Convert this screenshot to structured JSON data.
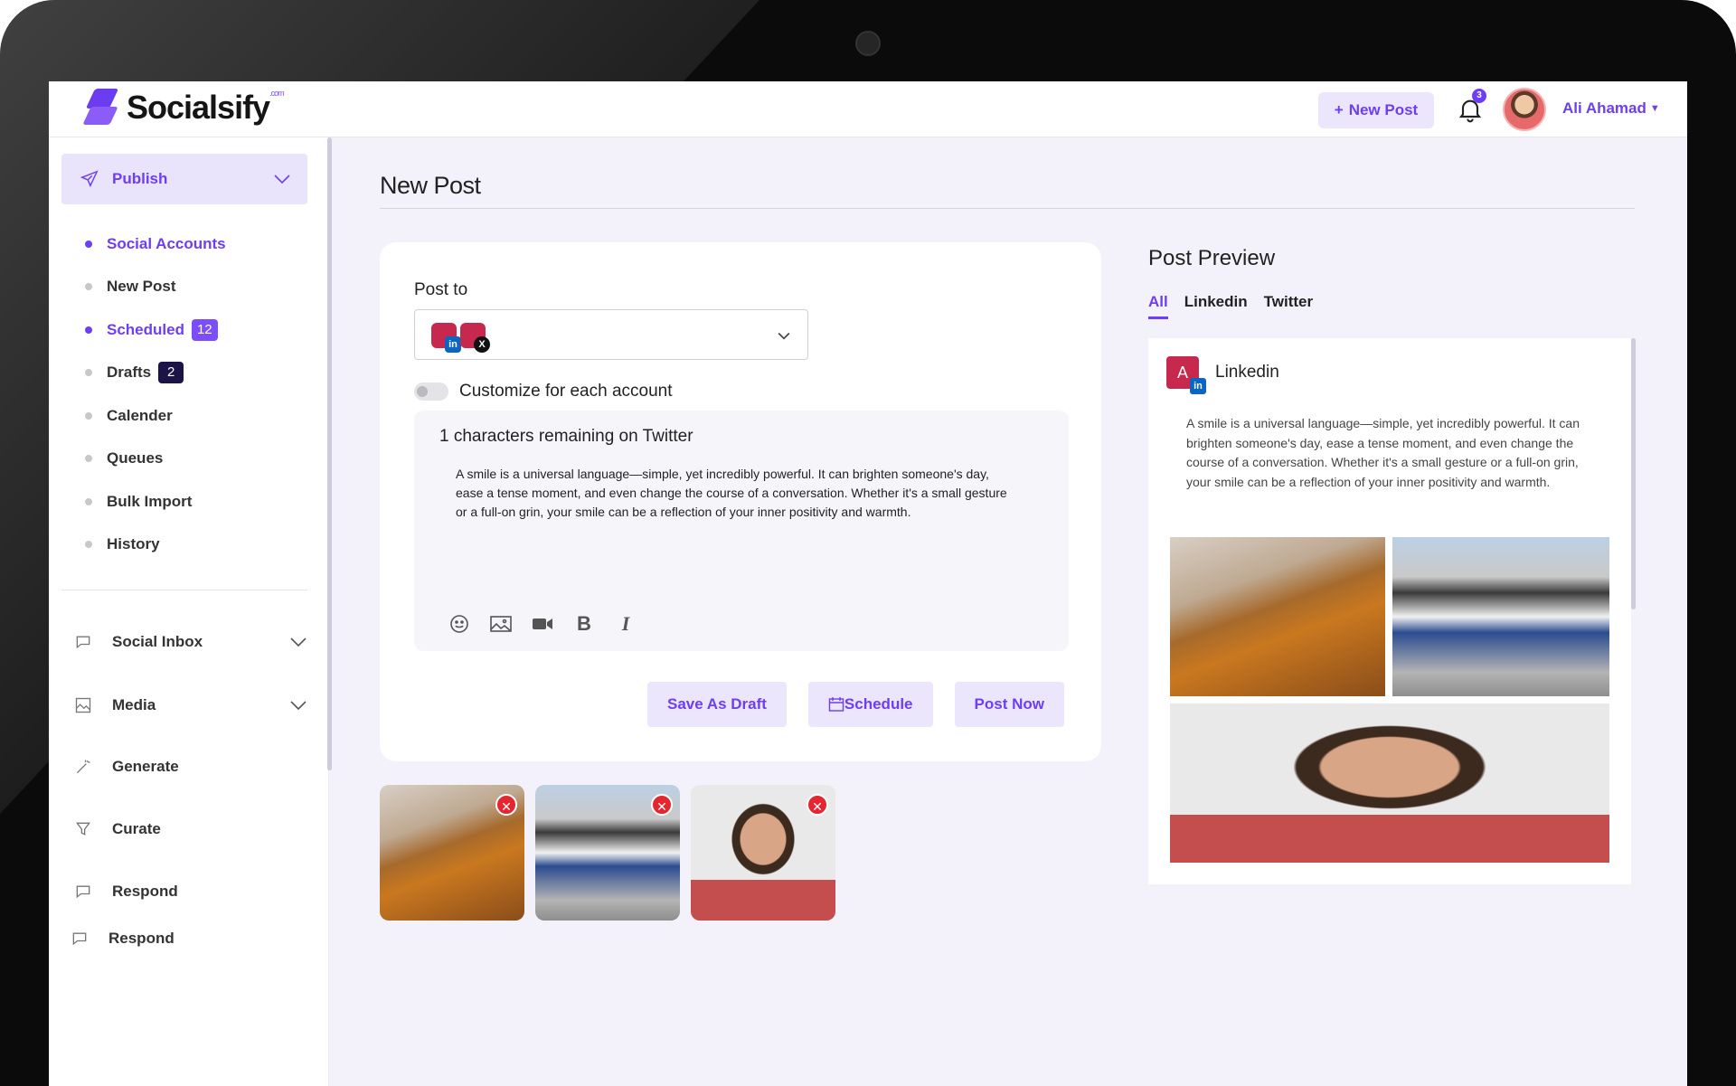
{
  "brand": {
    "name": "Socialsify",
    "suffix": ".com"
  },
  "topbar": {
    "new_post_label": "New Post",
    "notification_count": "3",
    "user_name": "Ali Ahamad"
  },
  "sidebar": {
    "publish_label": "Publish",
    "sub_items": [
      {
        "label": "Social Accounts",
        "active": true
      },
      {
        "label": "New Post",
        "active": false
      },
      {
        "label": "Scheduled",
        "active": true,
        "badge": "12"
      },
      {
        "label": "Drafts",
        "active": false,
        "badge": "2"
      },
      {
        "label": "Calender",
        "active": false
      },
      {
        "label": "Queues",
        "active": false
      },
      {
        "label": "Bulk Import",
        "active": false
      },
      {
        "label": "History",
        "active": false
      }
    ],
    "nav": [
      {
        "label": "Social Inbox",
        "icon": "chat-bubble-icon",
        "expandable": true
      },
      {
        "label": "Media",
        "icon": "media-icon",
        "expandable": true
      },
      {
        "label": "Generate",
        "icon": "magic-wand-icon",
        "expandable": false
      },
      {
        "label": "Curate",
        "icon": "filter-icon",
        "expandable": false
      },
      {
        "label": "Respond",
        "icon": "chat-bubble-icon",
        "expandable": false
      },
      {
        "label": "Respond",
        "icon": "chat-bubble-icon",
        "expandable": false
      }
    ]
  },
  "main": {
    "page_title": "New Post",
    "post_to_label": "Post to",
    "customize_label": "Customize for each account",
    "remaining_text": "1 characters remaining on Twitter",
    "post_text": "A smile is a universal language—simple, yet incredibly powerful. It can brighten someone's day, ease a tense moment, and even change the course of a conversation. Whether it's a small gesture or a full-on grin, your smile can be a reflection of your inner positivity and warmth.",
    "actions": {
      "save_draft": "Save As Draft",
      "schedule": "Schedule",
      "post_now": "Post Now"
    }
  },
  "preview": {
    "title": "Post Preview",
    "tabs": [
      {
        "label": "All",
        "active": true
      },
      {
        "label": "Linkedin",
        "active": false
      },
      {
        "label": "Twitter",
        "active": false
      }
    ],
    "account_initial": "A",
    "network_name": "Linkedin",
    "text": "A smile is a universal language—simple, yet incredibly powerful. It can brighten someone's day, ease a tense moment, and even change the course of a conversation. Whether it's a small gesture or a full-on grin, your smile can be a reflection of your inner positivity and warmth."
  },
  "colors": {
    "accent": "#6d3ef2",
    "accent_light": "#ebe6fc",
    "background": "#f3f2fb",
    "remove": "#e3262f"
  }
}
